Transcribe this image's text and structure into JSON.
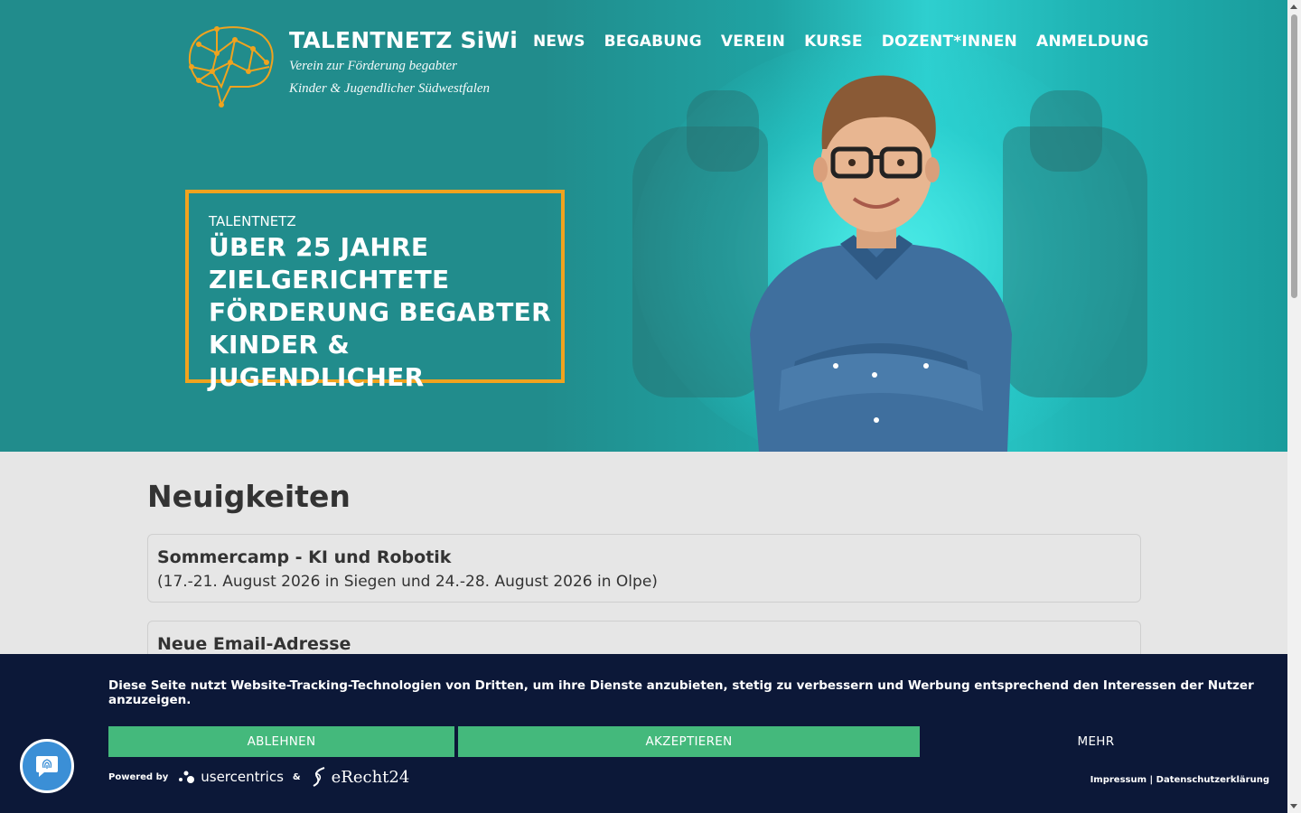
{
  "header": {
    "logo_title": "TALENTNETZ SiWi",
    "logo_sub_line1": "Verein zur Förderung begabter",
    "logo_sub_line2": "Kinder & Jugendlicher Südwestfalen",
    "nav": [
      "NEWS",
      "BEGABUNG",
      "VEREIN",
      "KURSE",
      "DOZENT*INNEN",
      "ANMELDUNG"
    ]
  },
  "hero": {
    "kicker": "TALENTNETZ",
    "headline_lines": [
      "ÜBER 25 JAHRE",
      "ZIELGERICHTETE",
      "FÖRDERUNG BEGABTER",
      "KINDER & JUGENDLICHER"
    ]
  },
  "main": {
    "heading": "Neuigkeiten",
    "news": [
      {
        "title": "Sommercamp - KI und Robotik",
        "subtitle": "(17.-21. August 2026 in Siegen und 24.-28. August 2026 in Olpe)"
      },
      {
        "title": "Neue Email-Adresse",
        "subtitle": ""
      }
    ]
  },
  "cookie": {
    "text": "Diese Seite nutzt Website-Tracking-Technologien von Dritten, um ihre Dienste anzubieten, stetig zu verbessern und Werbung entsprechend den Interessen der Nutzer anzuzeigen.",
    "deny": "ABLEHNEN",
    "accept": "AKZEPTIEREN",
    "more": "MEHR",
    "powered_by": "Powered by",
    "uc_name": "usercentrics",
    "amp": "&",
    "er_name": "eRecht24",
    "impressum": "Impressum",
    "separator": "|",
    "datenschutz": "Datenschutzerklärung"
  },
  "colors": {
    "hero_teal": "#218c8c",
    "accent_orange": "#f0a31e",
    "banner_navy": "#0c1838",
    "button_green": "#44b97c",
    "chat_blue": "#3b8fd6"
  },
  "icons": [
    "brain-logo-icon",
    "usercentrics-logo-icon",
    "erecht24-logo-icon",
    "fingerprint-chat-icon"
  ]
}
